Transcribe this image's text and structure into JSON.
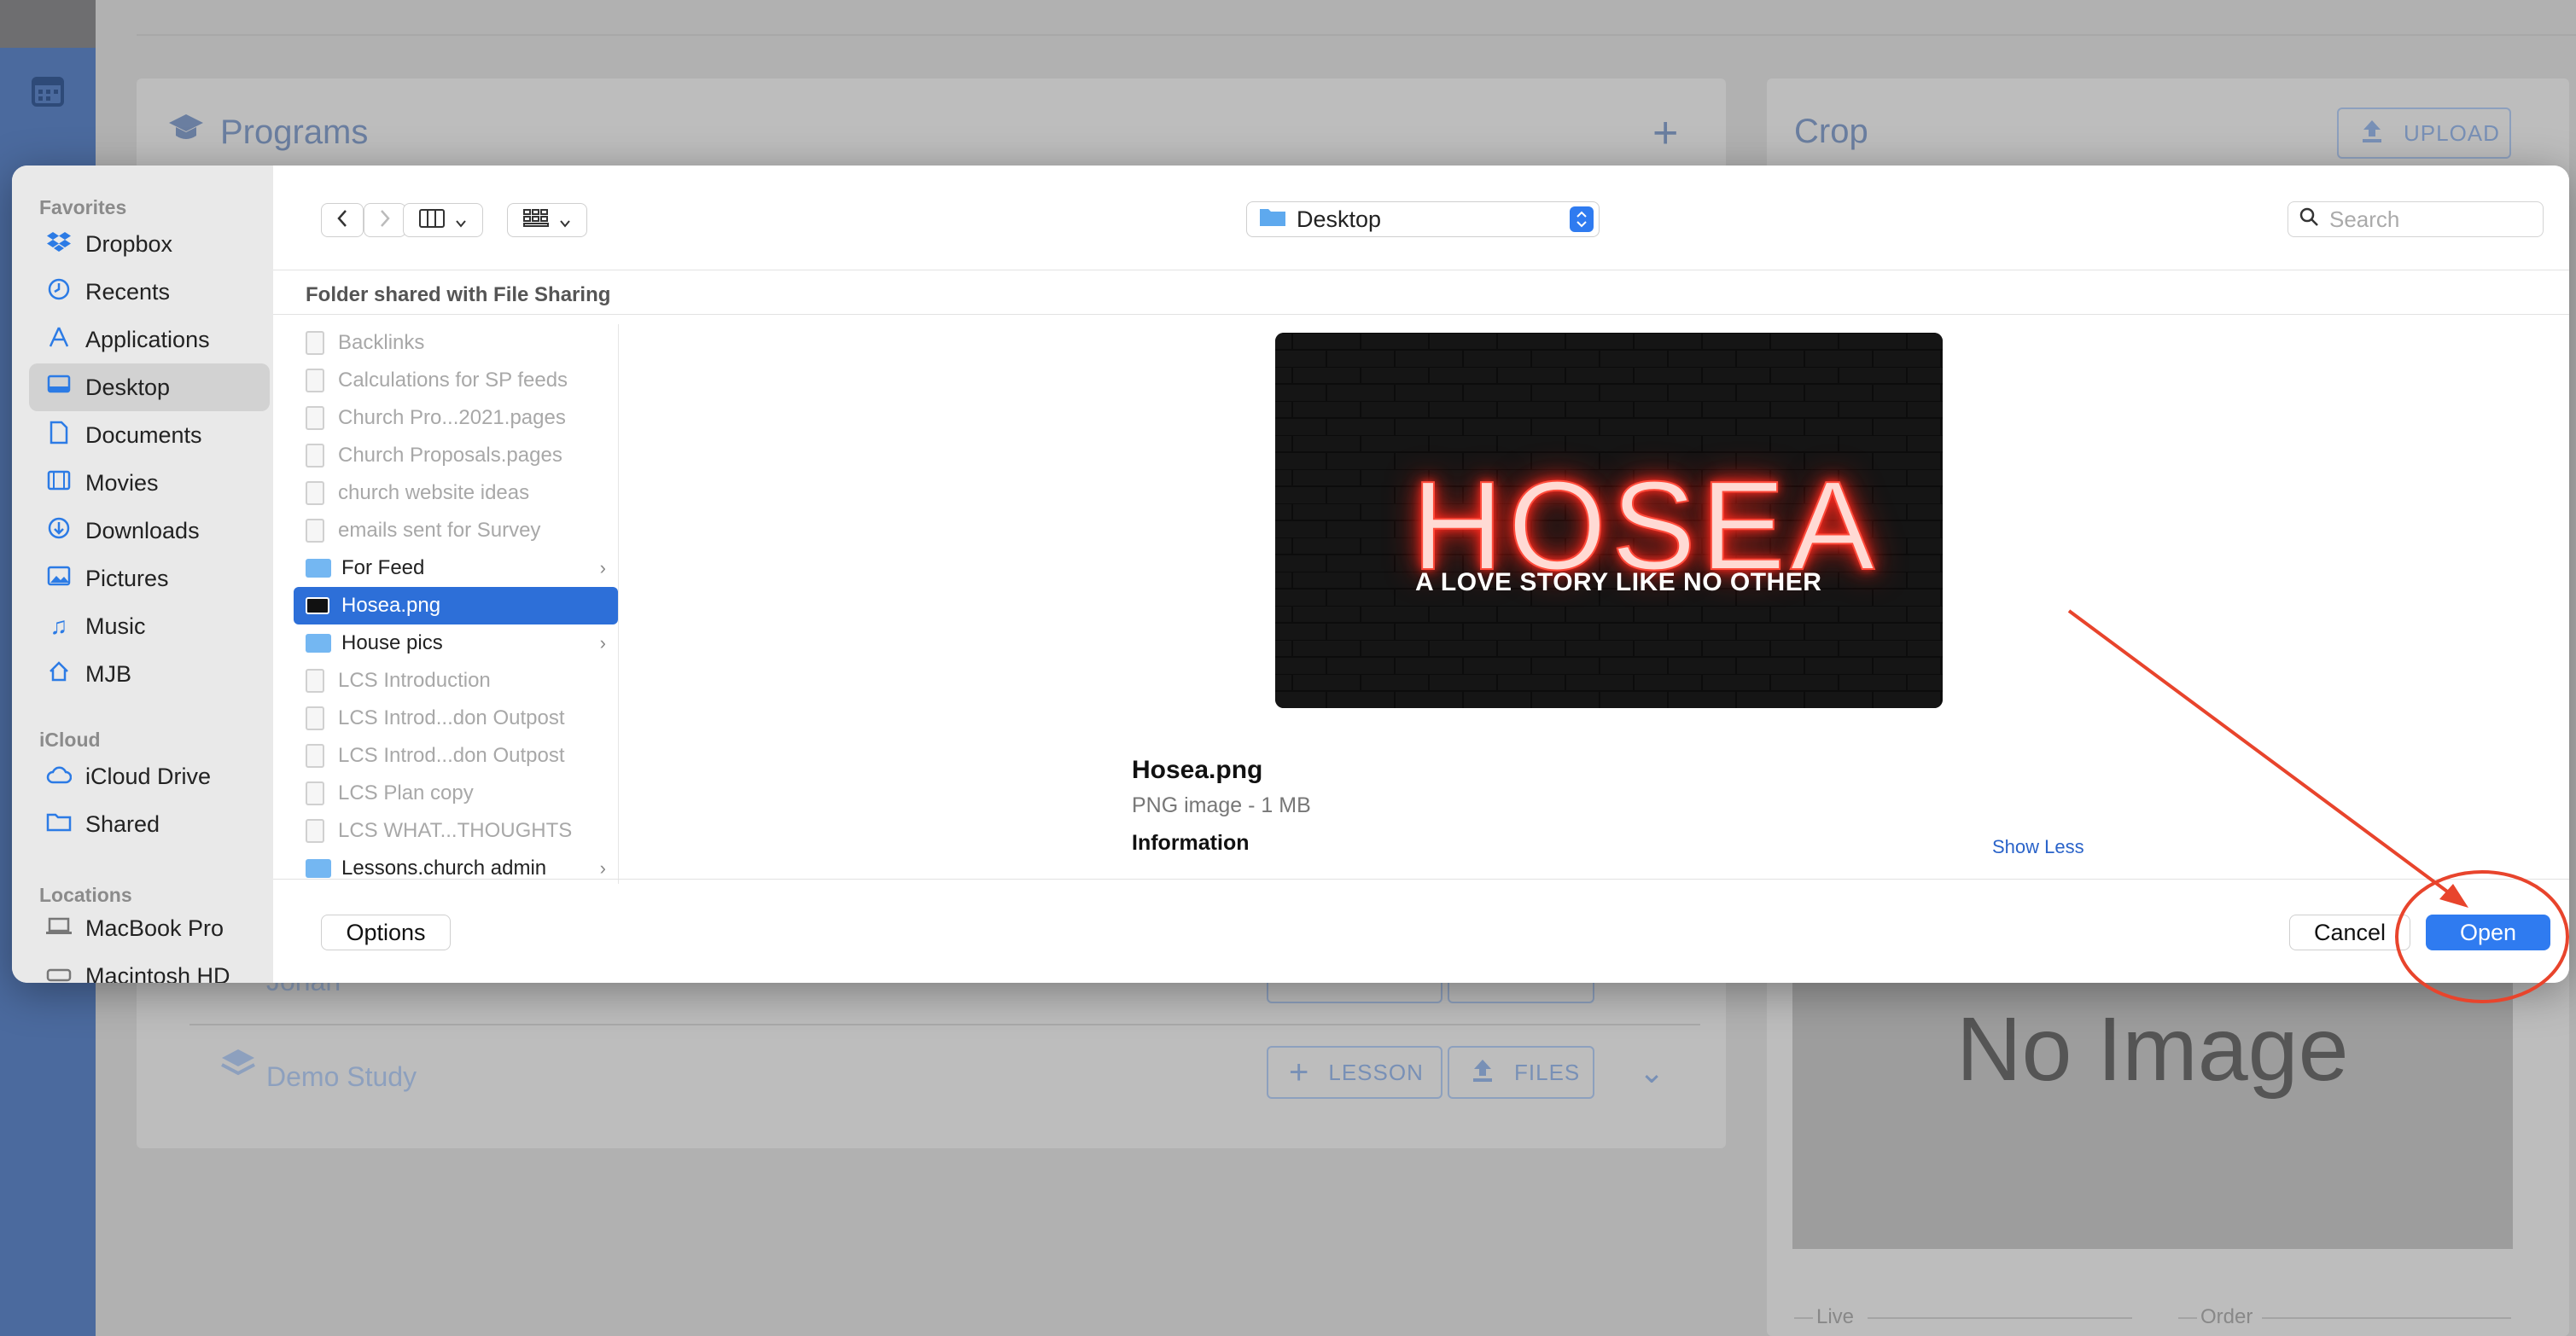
{
  "background_app": {
    "programs_title": "Programs",
    "crop_title": "Crop",
    "upload_label": "UPLOAD",
    "program_items": [
      {
        "name": "Jonah",
        "lesson_label": "LESSON",
        "files_label": "FILES"
      },
      {
        "name": "Demo Study",
        "lesson_label": "LESSON",
        "files_label": "FILES"
      }
    ],
    "no_image_text": "No Image",
    "live_label": "Live",
    "order_label": "Order"
  },
  "dialog": {
    "sidebar": {
      "favorites_header": "Favorites",
      "favorites": [
        {
          "label": "Dropbox",
          "icon": "dropbox-icon"
        },
        {
          "label": "Recents",
          "icon": "clock-icon"
        },
        {
          "label": "Applications",
          "icon": "applications-icon"
        },
        {
          "label": "Desktop",
          "icon": "desktop-icon",
          "selected": true
        },
        {
          "label": "Documents",
          "icon": "document-icon"
        },
        {
          "label": "Movies",
          "icon": "film-icon"
        },
        {
          "label": "Downloads",
          "icon": "download-icon"
        },
        {
          "label": "Pictures",
          "icon": "photo-icon"
        },
        {
          "label": "Music",
          "icon": "music-note-icon"
        },
        {
          "label": "MJB",
          "icon": "home-icon"
        }
      ],
      "icloud_header": "iCloud",
      "icloud": [
        {
          "label": "iCloud Drive",
          "icon": "cloud-icon"
        },
        {
          "label": "Shared",
          "icon": "shared-folder-icon"
        }
      ],
      "locations_header": "Locations",
      "locations": [
        {
          "label": "MacBook Pro",
          "icon": "laptop-icon"
        },
        {
          "label": "Macintosh HD",
          "icon": "disk-icon"
        }
      ]
    },
    "toolbar": {
      "location": "Desktop",
      "search_placeholder": "Search"
    },
    "shared_header": "Folder shared with File Sharing",
    "files": [
      {
        "name": "Backlinks",
        "kind": "doc",
        "dimmed": true
      },
      {
        "name": "Calculations for SP feeds",
        "kind": "doc",
        "dimmed": true
      },
      {
        "name": "Church Pro...2021.pages",
        "kind": "doc",
        "dimmed": true
      },
      {
        "name": "Church Proposals.pages",
        "kind": "doc",
        "dimmed": true
      },
      {
        "name": "church website ideas",
        "kind": "doc",
        "dimmed": true
      },
      {
        "name": "emails sent for Survey",
        "kind": "doc",
        "dimmed": true
      },
      {
        "name": "For Feed",
        "kind": "folder",
        "dimmed": false
      },
      {
        "name": "Hosea.png",
        "kind": "image",
        "selected": true
      },
      {
        "name": "House pics",
        "kind": "folder",
        "dimmed": false
      },
      {
        "name": "LCS Introduction",
        "kind": "doc",
        "dimmed": true
      },
      {
        "name": "LCS Introd...don Outpost",
        "kind": "doc",
        "dimmed": true
      },
      {
        "name": "LCS Introd...don Outpost",
        "kind": "doc",
        "dimmed": true
      },
      {
        "name": "LCS Plan copy",
        "kind": "doc",
        "dimmed": true
      },
      {
        "name": "LCS WHAT...THOUGHTS",
        "kind": "doc",
        "dimmed": true
      },
      {
        "name": "Lessons.church admin",
        "kind": "folder",
        "dimmed": false
      }
    ],
    "preview": {
      "image_title": "HOSEA",
      "image_subtitle": "A LOVE STORY LIKE NO OTHER",
      "file_name": "Hosea.png",
      "file_kind": "PNG image - 1 MB",
      "info_header": "Information",
      "show_less": "Show Less"
    },
    "footer": {
      "options_label": "Options",
      "cancel_label": "Cancel",
      "open_label": "Open"
    }
  },
  "annotation": {
    "color": "#e8442c"
  }
}
